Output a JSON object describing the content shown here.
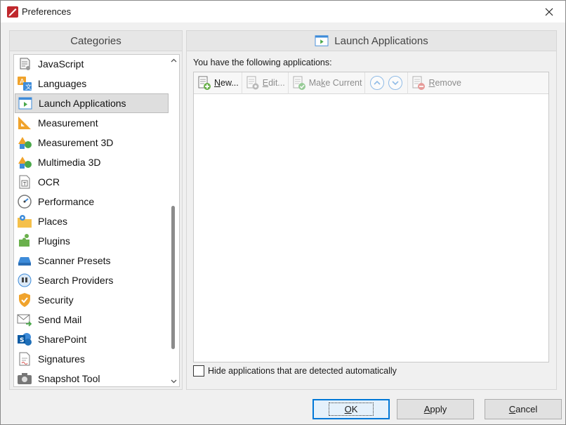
{
  "window": {
    "title": "Preferences"
  },
  "categories": {
    "header": "Categories",
    "items": [
      {
        "label": "JavaScript",
        "icon": "javascript-icon"
      },
      {
        "label": "Languages",
        "icon": "languages-icon"
      },
      {
        "label": "Launch Applications",
        "icon": "launch-applications-icon",
        "selected": true
      },
      {
        "label": "Measurement",
        "icon": "measurement-icon"
      },
      {
        "label": "Measurement 3D",
        "icon": "measurement-3d-icon"
      },
      {
        "label": "Multimedia 3D",
        "icon": "multimedia-3d-icon"
      },
      {
        "label": "OCR",
        "icon": "ocr-icon"
      },
      {
        "label": "Performance",
        "icon": "performance-icon"
      },
      {
        "label": "Places",
        "icon": "places-icon"
      },
      {
        "label": "Plugins",
        "icon": "plugins-icon"
      },
      {
        "label": "Scanner Presets",
        "icon": "scanner-icon"
      },
      {
        "label": "Search Providers",
        "icon": "search-providers-icon"
      },
      {
        "label": "Security",
        "icon": "security-icon"
      },
      {
        "label": "Send Mail",
        "icon": "send-mail-icon"
      },
      {
        "label": "SharePoint",
        "icon": "sharepoint-icon"
      },
      {
        "label": "Signatures",
        "icon": "signatures-icon"
      },
      {
        "label": "Snapshot Tool",
        "icon": "snapshot-tool-icon"
      }
    ]
  },
  "main": {
    "header": "Launch Applications",
    "apps_label": "You have the following applications:",
    "toolbar": {
      "new": {
        "mnemonic": "N",
        "rest": "ew..."
      },
      "edit": {
        "mnemonic": "E",
        "rest": "dit..."
      },
      "make_current": {
        "pre": "Ma",
        "mnemonic": "k",
        "rest": "e Current"
      },
      "remove": {
        "mnemonic": "R",
        "rest": "emove"
      }
    },
    "hide_checkbox": {
      "label": "Hide applications that are detected automatically",
      "checked": false
    }
  },
  "buttons": {
    "ok": {
      "mnemonic": "O",
      "rest": "K"
    },
    "apply": {
      "mnemonic": "A",
      "rest": "pply"
    },
    "cancel": {
      "mnemonic": "C",
      "rest": "ancel"
    }
  }
}
